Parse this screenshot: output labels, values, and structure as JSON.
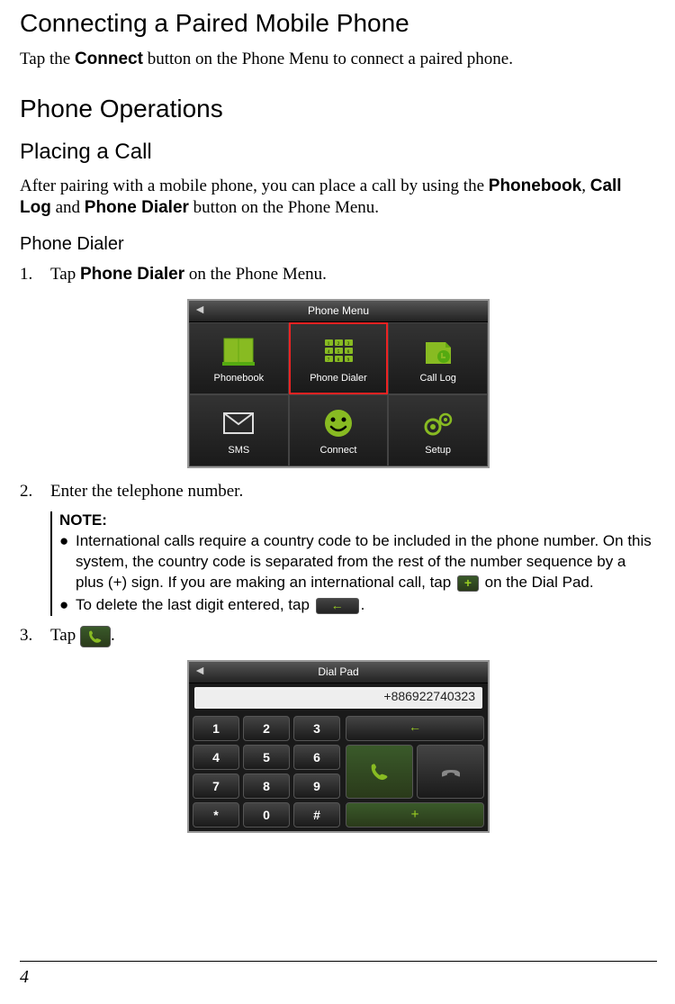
{
  "h1": "Connecting a Paired Mobile Phone",
  "intro_pre": "Tap the ",
  "intro_bold": "Connect",
  "intro_post": " button on the Phone Menu to connect a paired phone.",
  "h2": "Phone Operations",
  "h3": "Placing a Call",
  "placing_pre": "After pairing with a mobile phone, you can place a call by using the ",
  "placing_b1": "Phonebook",
  "placing_mid1": ", ",
  "placing_b2": "Call Log",
  "placing_mid2": " and ",
  "placing_b3": "Phone Dialer",
  "placing_post": " button on the Phone Menu.",
  "h4": "Phone Dialer",
  "step1_num": "1.",
  "step1_pre": "Tap ",
  "step1_bold": "Phone Dialer",
  "step1_post": " on the Phone Menu.",
  "phone_menu": {
    "title": "Phone Menu",
    "items": [
      "Phonebook",
      "Phone Dialer",
      "Call Log",
      "SMS",
      "Connect",
      "Setup"
    ]
  },
  "step2_num": "2.",
  "step2_text": "Enter the telephone number.",
  "note": {
    "title": "NOTE:",
    "b1_pre": "International calls require a country code to be included in the phone number. On this system, the country code is separated from the rest of the number sequence by a plus (+) sign. If you are making an international call, tap ",
    "b1_post": " on the Dial Pad.",
    "b2_pre": "To delete the last digit entered, tap ",
    "b2_post": "."
  },
  "step3_num": "3.",
  "step3_pre": "Tap ",
  "step3_post": ".",
  "dial_pad": {
    "title": "Dial Pad",
    "display": "+886922740323",
    "keys": [
      "1",
      "2",
      "3",
      "4",
      "5",
      "6",
      "7",
      "8",
      "9",
      "*",
      "0",
      "#"
    ],
    "plus": "+"
  },
  "page_number": "4",
  "glyph_plus": "+",
  "glyph_back": "←",
  "glyph_back_header": "◄"
}
